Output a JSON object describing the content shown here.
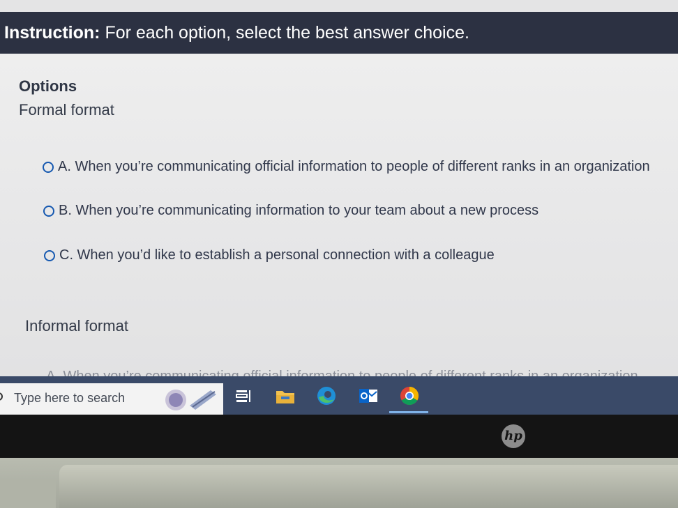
{
  "instruction": {
    "label": "Instruction:",
    "text": " For each option, select the best answer choice."
  },
  "options_heading": "Options",
  "groups": [
    {
      "title": "Formal format",
      "choices": [
        "A. When you’re communicating official information to people of different ranks in an organization",
        "B. When you’re communicating information to your team about a new process",
        "C. When you’d like to establish a personal connection with a colleague"
      ]
    },
    {
      "title": "Informal format",
      "choices": [
        "A. When you’re communicating official information to people of different ranks in an organization"
      ]
    }
  ],
  "taskbar": {
    "search_placeholder": "Type here to search",
    "apps": [
      "task-view-icon",
      "file-explorer-icon",
      "edge-icon",
      "outlook-icon",
      "chrome-icon"
    ]
  },
  "bezel": {
    "logo": "hp"
  },
  "colors": {
    "instruction_bar": "#2c3142",
    "radio": "#1558b0",
    "taskbar": "#3a4a68"
  }
}
